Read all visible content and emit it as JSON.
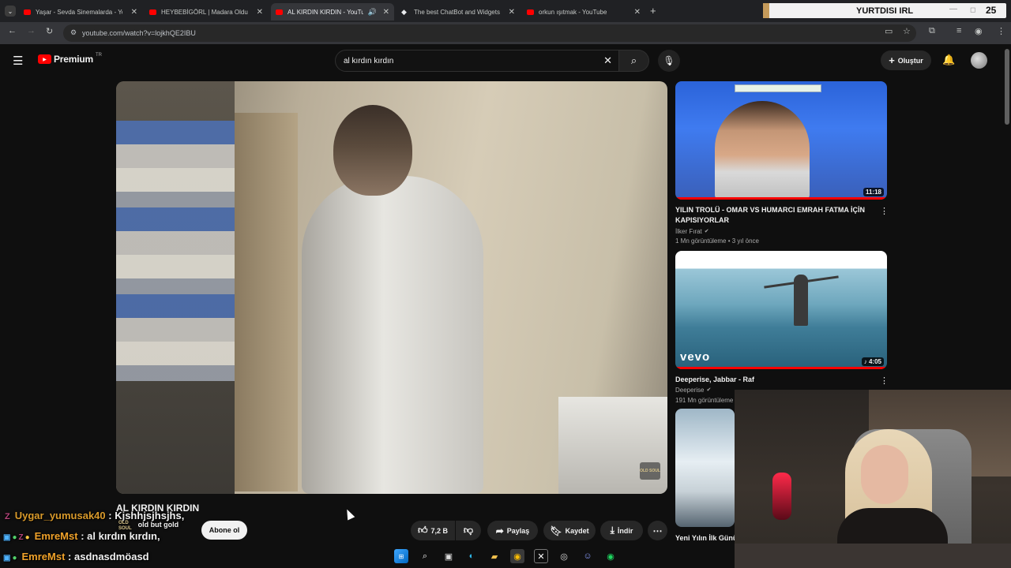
{
  "browser": {
    "tabs": [
      {
        "title": "Yaşar - Sevda Sinemalarda - YouTube",
        "icon": "youtube-icon",
        "active": false
      },
      {
        "title": "HEYBEBİGÖRL | Madara Olduk -",
        "icon": "youtube-icon",
        "active": false
      },
      {
        "title": "AL KIRDIN KIRDIN - YouTube",
        "icon": "youtube-icon",
        "active": true
      },
      {
        "title": "The best ChatBot and Widgets",
        "icon": "chatbot-icon",
        "active": false
      },
      {
        "title": "orkun ışıtmak - YouTube",
        "icon": "youtube-icon",
        "active": false
      }
    ],
    "url": "youtube.com/watch?v=lojkhQE2IBU"
  },
  "overlay": {
    "banner_label": "YURTDISI IRL",
    "viewer_count": "25"
  },
  "youtube": {
    "logo_text": "Premium",
    "logo_region": "TR",
    "search_value": "al kırdın kırdın",
    "create_label": "Oluştur",
    "video": {
      "watermark": "OLD SOUL",
      "title": "AL KIRDIN KIRDIN",
      "subscribe_label": "Abone ol",
      "likes": "7,2 B",
      "share_label": "Paylaş",
      "save_label": "Kaydet",
      "download_label": "İndir"
    },
    "recommendations": [
      {
        "title": "YILIN TROLÜ - OMAR VS HUMARCI EMRAH FATMA İÇİN KAPISIYORLAR",
        "channel": "İlker Fırat",
        "meta": "1 Mn görüntüleme • 3 yıl önce",
        "duration": "11:18",
        "verified": true
      },
      {
        "title": "Deeperise, Jabbar - Raf",
        "channel": "Deeperise",
        "meta": "191 Mn görüntüleme",
        "duration": "4:05",
        "verified": true,
        "badge": "vevo"
      },
      {
        "title": "Yeni Yılın İlk Günü",
        "channel": "",
        "meta": "",
        "duration": "",
        "verified": false
      }
    ]
  },
  "chat": [
    {
      "user": "Uygar_yumusak40",
      "message": "Kjshhjsjhsjhs,",
      "user_color": "#d99a2b"
    },
    {
      "user": "EmreMst",
      "message": "al kırdın kırdın,",
      "user_color": "#f0a22a"
    },
    {
      "user": "EmreMst",
      "message": "asdnasdmöasd",
      "user_color": "#f0a22a"
    }
  ],
  "chat_badge_text": "old but gold",
  "colors": {
    "youtube_red": "#ff0000",
    "background": "#0f0f0f",
    "pill": "#272727"
  }
}
